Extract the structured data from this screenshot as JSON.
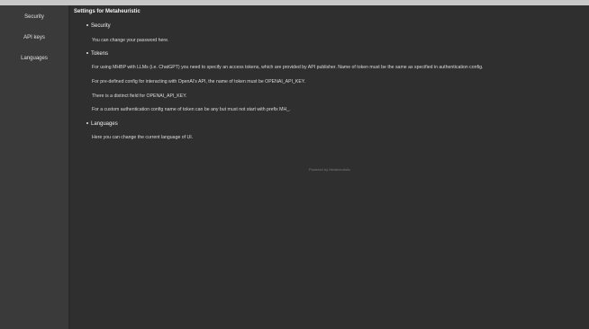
{
  "sidebar": {
    "items": [
      {
        "label": "Security"
      },
      {
        "label": "API keys"
      },
      {
        "label": "Languages"
      }
    ]
  },
  "main": {
    "title": "Settings for Metaheuristic",
    "sections": [
      {
        "heading": "Security",
        "paragraphs": [
          "You can change your password here."
        ]
      },
      {
        "heading": "Tokens",
        "paragraphs": [
          "For using MHBP with LLMs (i.e. ChatGPT) you need to specify an access tokens, which are provided by API publisher. Name of token must be the same as specified in authentication config.",
          "For pre-defined config for interacting with OpenAI's API, the name of token must be OPENAI_API_KEY.",
          "There is a distinct field for OPENAI_API_KEY.",
          "For a custom authentication config name of token can be any but must not start with prefix MH_."
        ]
      },
      {
        "heading": "Languages",
        "paragraphs": [
          "Here you can change the current language of UI."
        ]
      }
    ],
    "footer": "Powered by Metaheuristic"
  }
}
